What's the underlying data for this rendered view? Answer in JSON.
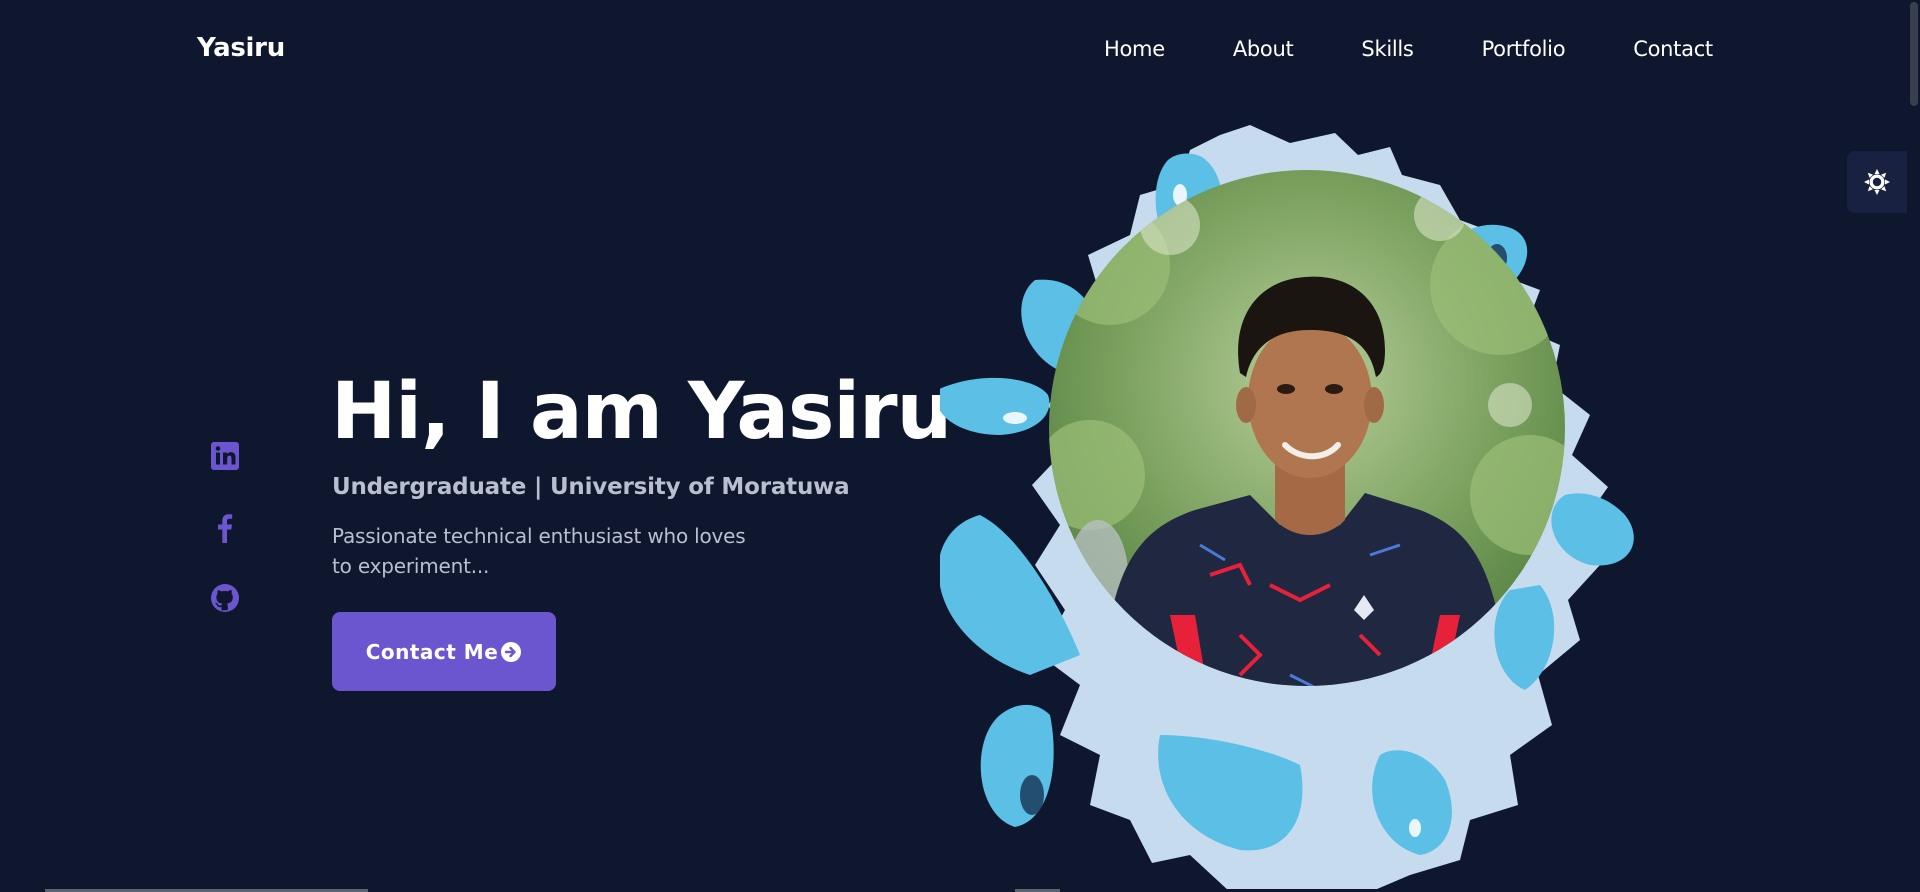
{
  "header": {
    "logo": "Yasiru",
    "nav": [
      "Home",
      "About",
      "Skills",
      "Portfolio",
      "Contact"
    ]
  },
  "theme_toggle": {
    "icon": "sun-icon"
  },
  "socials": [
    {
      "name": "linkedin",
      "icon": "linkedin-icon"
    },
    {
      "name": "facebook",
      "icon": "facebook-icon"
    },
    {
      "name": "github",
      "icon": "github-icon"
    }
  ],
  "hero": {
    "title": "Hi, I am Yasiru",
    "subtitle": "Undergraduate | University of Moratuwa",
    "description_line1": "Passionate technical enthusiast who loves",
    "description_line2": "to experiment...",
    "cta_label": "Contact Me",
    "cta_icon": "arrow-right-circle-icon",
    "image_alt": "profile-photo"
  },
  "colors": {
    "background": "#0f172e",
    "accent": "#6c56d0",
    "social_icon": "#6c56d0",
    "splash_light": "#c6dcee",
    "splash_blue": "#5bbfe6",
    "text_muted": "#b9bfd0"
  }
}
